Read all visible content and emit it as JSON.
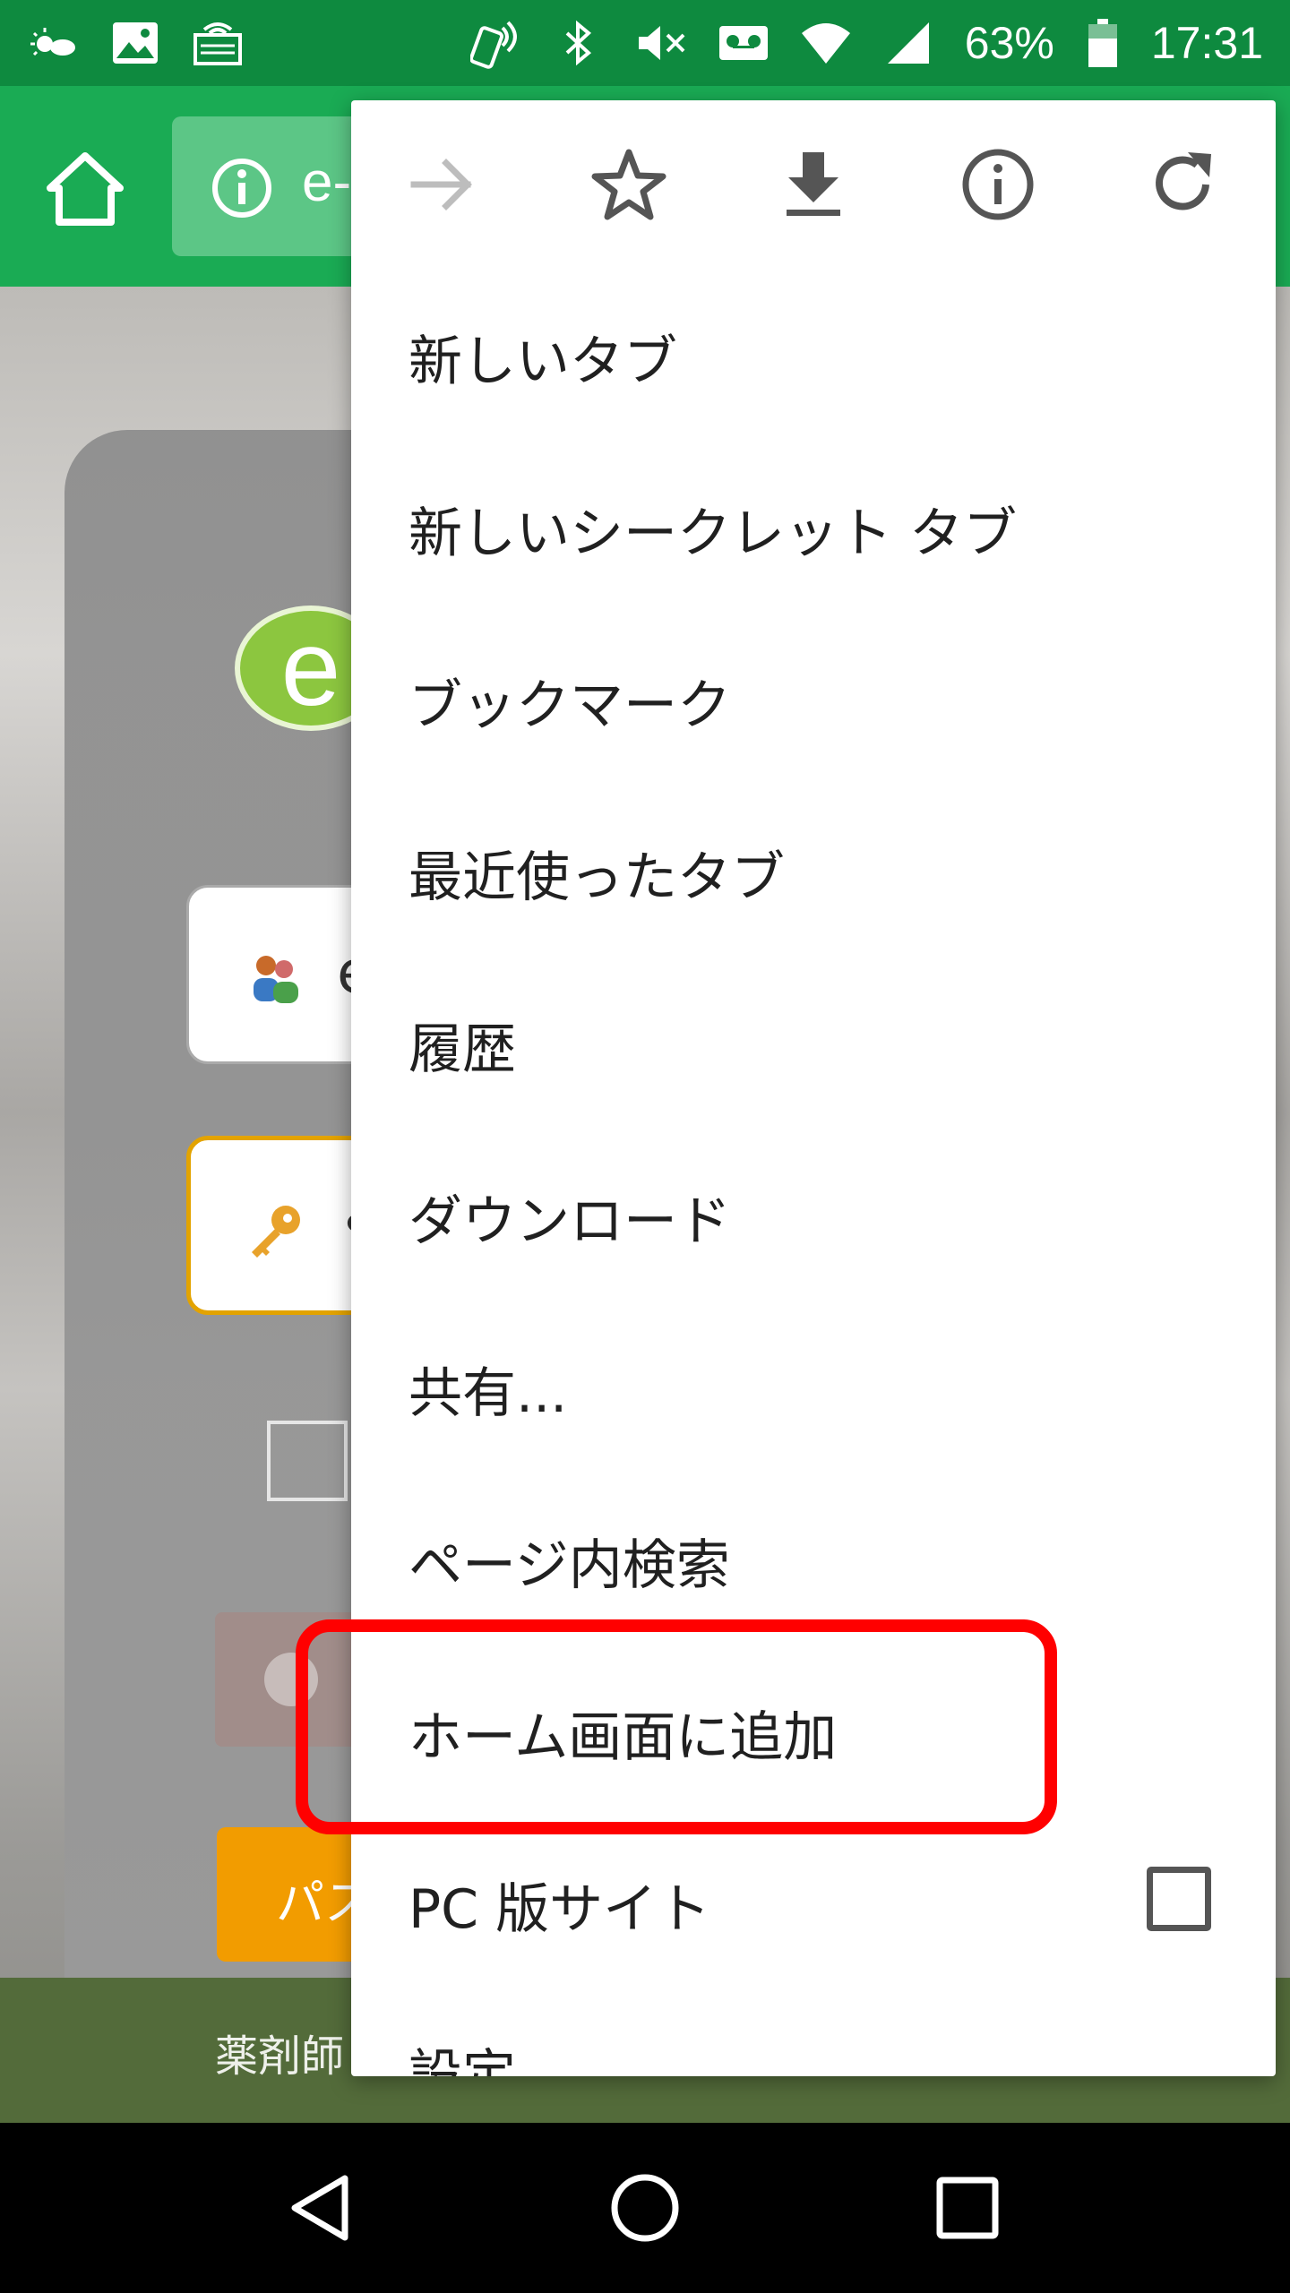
{
  "status_bar": {
    "battery_percent": "63%",
    "time": "17:31"
  },
  "toolbar": {
    "url_text": "e-"
  },
  "background_page": {
    "logo_letter": "e",
    "username_value": "e",
    "password_value": "•",
    "button_label": "パス",
    "footer_text": "薬剤師"
  },
  "menu": {
    "items": [
      {
        "label": "新しいタブ"
      },
      {
        "label": "新しいシークレット タブ"
      },
      {
        "label": "ブックマーク"
      },
      {
        "label": "最近使ったタブ"
      },
      {
        "label": "履歴"
      },
      {
        "label": "ダウンロード"
      },
      {
        "label": "共有..."
      },
      {
        "label": "ページ内検索"
      },
      {
        "label": "ホーム画面に追加"
      },
      {
        "label": "PC 版サイト"
      },
      {
        "label": "設定"
      }
    ]
  },
  "colors": {
    "status_bar": "#0e8a3f",
    "toolbar": "#1aab54",
    "highlight": "#ff0000"
  }
}
